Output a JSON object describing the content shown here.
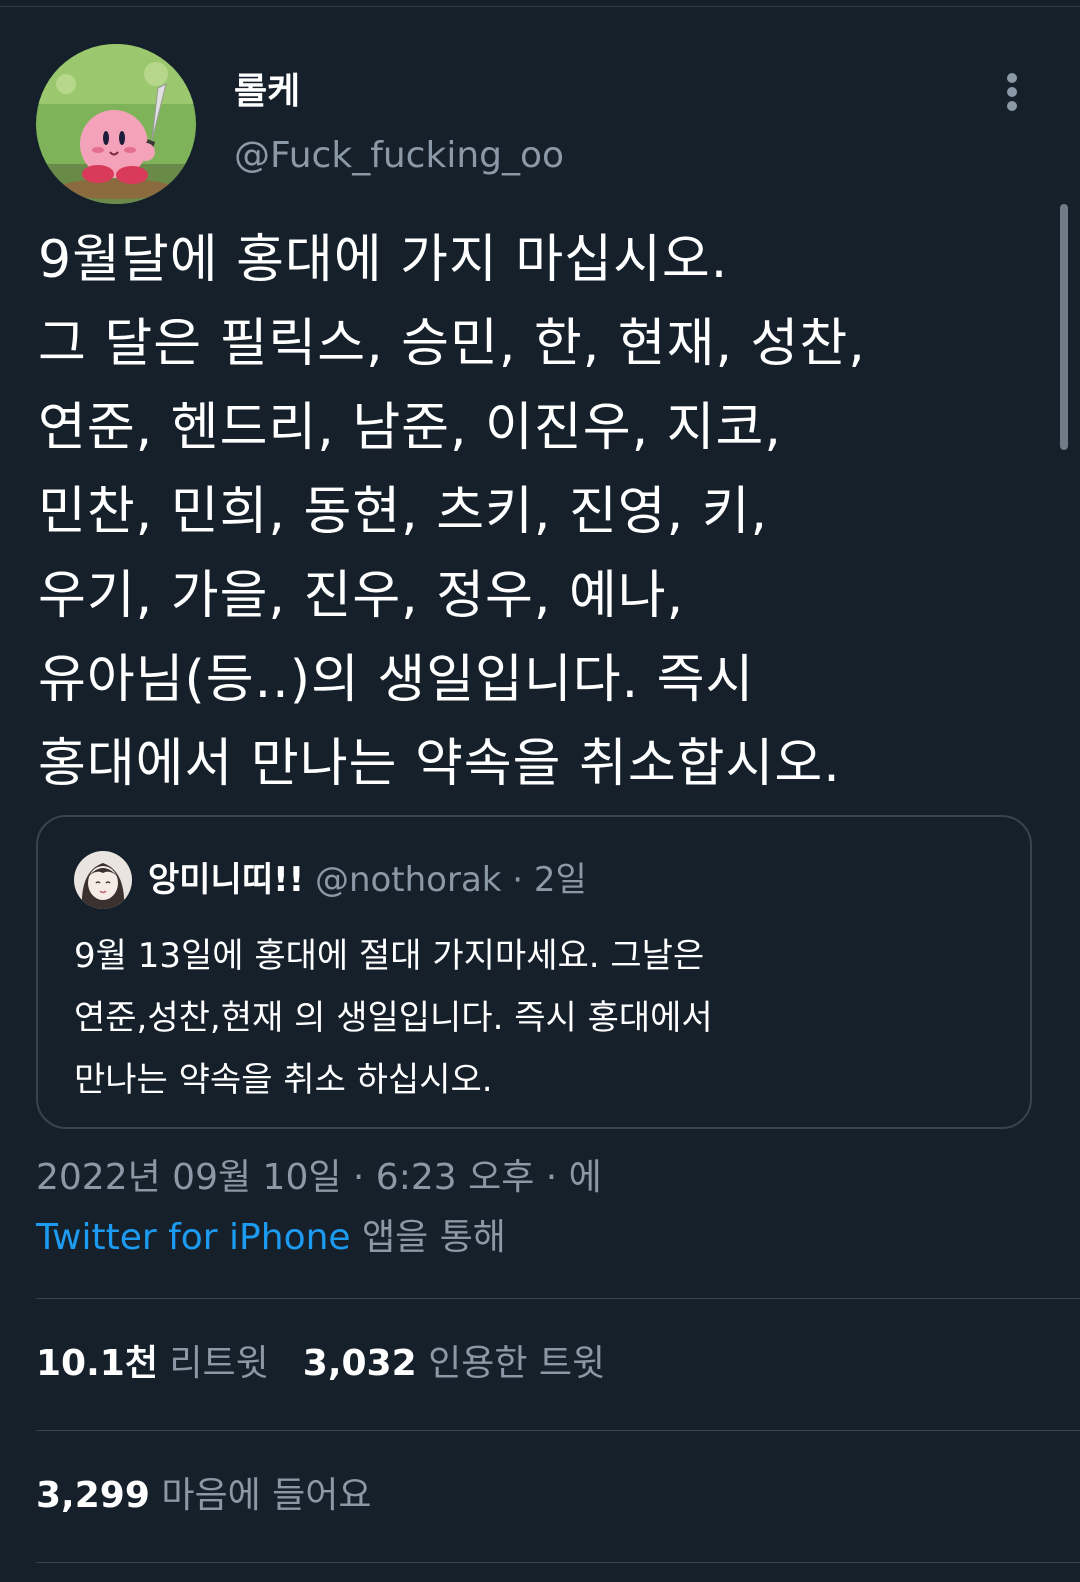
{
  "author": {
    "display_name": "롤케",
    "handle": "@Fuck_fucking_oo"
  },
  "tweet_lines": [
    "9월달에 홍대에 가지 마십시오.",
    "그 달은 필릭스, 승민, 한, 현재, 성찬,",
    "연준, 헨드리, 남준, 이진우, 지코,",
    "민찬, 민희, 동현, 츠키, 진영, 키,",
    "우기, 가을, 진우, 정우, 예나,",
    "유아님(등..)의 생일입니다. 즉시",
    "홍대에서 만나는 약속을 취소합시오."
  ],
  "quote": {
    "display_name": "앙미니띠!!",
    "meta": "@nothorak · 2일",
    "lines": [
      "9월 13일에 홍대에 절대 가지마세요. 그날은",
      "연준,성찬,현재 의 생일입니다. 즉시 홍대에서",
      "만나는 약속을 취소 하십시오."
    ]
  },
  "timestamp": "2022년 09월 10일 · 6:23 오후 · 에",
  "source": {
    "client": "Twitter for iPhone",
    "suffix": " 앱을 통해"
  },
  "stats": {
    "retweets_count": "10.1천",
    "retweets_label": "리트윗",
    "quotes_count": "3,032",
    "quotes_label": "인용한 트윗",
    "likes_count": "3,299",
    "likes_label": "마음에 들어요"
  },
  "colors": {
    "background": "#15202b",
    "text_primary": "#ffffff",
    "text_secondary": "#8b98a5",
    "link": "#1d9bf0",
    "border": "#38444d"
  },
  "icons": {
    "more": "vertical-ellipsis-icon"
  }
}
